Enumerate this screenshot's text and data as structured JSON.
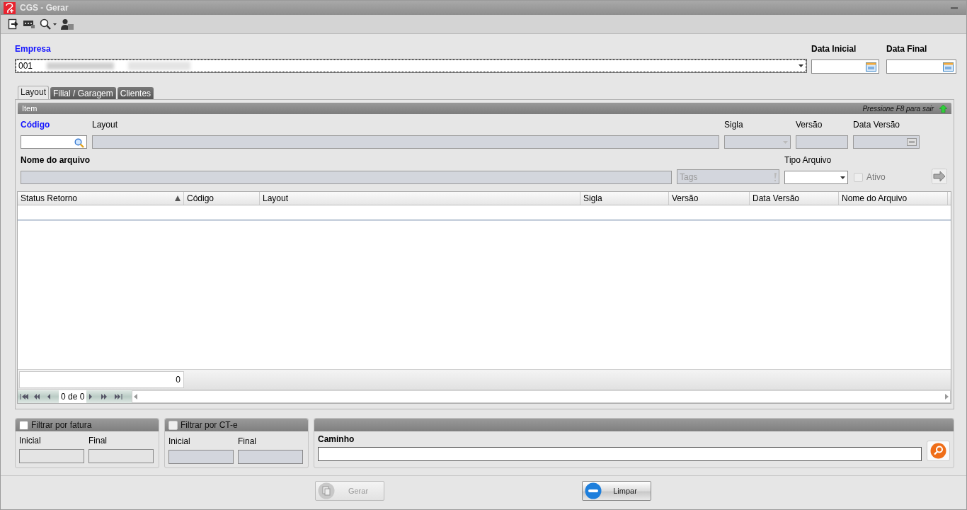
{
  "window": {
    "title": "CGS - Gerar"
  },
  "empresa": {
    "label": "Empresa",
    "value": "001"
  },
  "dates": [
    {
      "label": "Data Inicial"
    },
    {
      "label": "Data Final"
    }
  ],
  "tabs": [
    {
      "label": "Layout",
      "selected": true
    },
    {
      "label": "Filial / Garagem",
      "selected": false
    },
    {
      "label": "Clientes",
      "selected": false
    }
  ],
  "item_panel": {
    "title": "Item",
    "hint": "Pressione F8 para sair"
  },
  "item_fields": {
    "codigo": {
      "label": "Código",
      "disabled": false
    },
    "layout": {
      "label": "Layout",
      "disabled": true
    },
    "sigla": {
      "label": "Sigla",
      "disabled": true
    },
    "versao": {
      "label": "Versão",
      "disabled": true
    },
    "data_versao": {
      "label": "Data Versão",
      "disabled": true
    },
    "nome_arquivo": {
      "label": "Nome do arquivo",
      "disabled": true
    },
    "tags": {
      "placeholder": "Tags",
      "disabled": true
    },
    "tipo_arquivo": {
      "label": "Tipo Arquivo",
      "disabled": false
    },
    "ativo": {
      "label": "Ativo",
      "checked": false,
      "disabled": true
    }
  },
  "grid": {
    "columns": [
      {
        "label": "Status Retorno",
        "sorted": true
      },
      {
        "label": "Código",
        "sorted": false
      },
      {
        "label": "Layout",
        "sorted": false
      },
      {
        "label": "Sigla",
        "sorted": false
      },
      {
        "label": "Versão",
        "sorted": false
      },
      {
        "label": "Data Versão",
        "sorted": false
      },
      {
        "label": "Nome do Arquivo",
        "sorted": false
      }
    ],
    "total": "0",
    "pager": "0 de 0"
  },
  "filters": [
    {
      "title": "Filtrar por fatura",
      "checked": false,
      "disabled": false,
      "fields": [
        {
          "label": "Inicial"
        },
        {
          "label": "Final"
        }
      ]
    },
    {
      "title": "Filtrar por CT-e",
      "checked": false,
      "disabled": true,
      "fields": [
        {
          "label": "Inicial"
        },
        {
          "label": "Final"
        }
      ]
    }
  ],
  "caminho": {
    "label": "Caminho"
  },
  "buttons": [
    {
      "label": "Gerar",
      "kind": "generate",
      "disabled": true
    },
    {
      "label": "Limpar",
      "kind": "clear",
      "disabled": false
    }
  ]
}
